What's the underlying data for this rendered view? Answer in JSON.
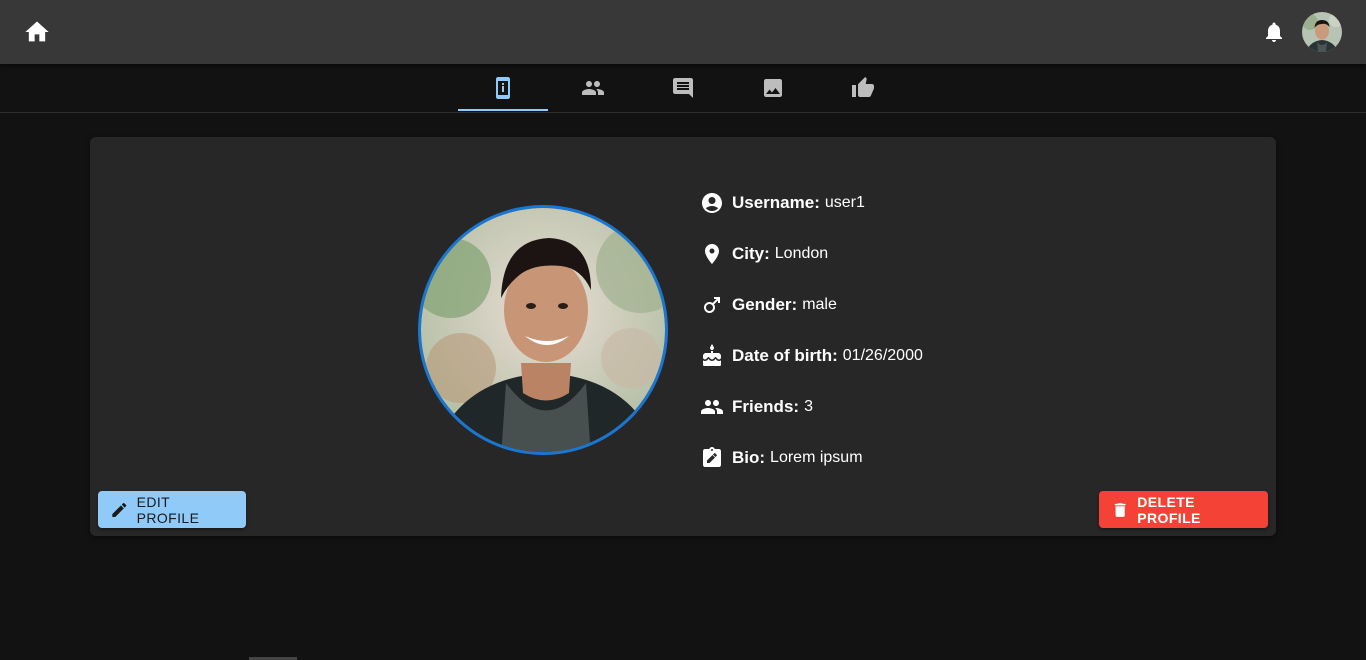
{
  "colors": {
    "appbar": "#383838",
    "background": "#121212",
    "card": "#272727",
    "tab_active": "#90caf9",
    "edit_button": "#90caf9",
    "delete_button": "#f44336",
    "photo_border": "#1976d2"
  },
  "appbar": {
    "home_icon": "home-icon",
    "notifications_icon": "bell-icon",
    "avatar": "user-avatar"
  },
  "tabs": [
    {
      "icon": "info-phone-icon",
      "active": true
    },
    {
      "icon": "people-icon",
      "active": false
    },
    {
      "icon": "comment-icon",
      "active": false
    },
    {
      "icon": "image-icon",
      "active": false
    },
    {
      "icon": "thumb-up-icon",
      "active": false
    }
  ],
  "profile": {
    "rows": [
      {
        "icon": "account-circle-icon",
        "label": "Username:",
        "value": "user1"
      },
      {
        "icon": "location-pin-icon",
        "label": "City:",
        "value": "London"
      },
      {
        "icon": "male-icon",
        "label": "Gender:",
        "value": "male"
      },
      {
        "icon": "cake-icon",
        "label": "Date of birth:",
        "value": "01/26/2000"
      },
      {
        "icon": "people-icon",
        "label": "Friends:",
        "value": "3"
      },
      {
        "icon": "assignment-edit-icon",
        "label": "Bio:",
        "value": "Lorem ipsum"
      }
    ]
  },
  "actions": {
    "edit_label": "EDIT PROFILE",
    "delete_label": "DELETE PROFILE"
  }
}
